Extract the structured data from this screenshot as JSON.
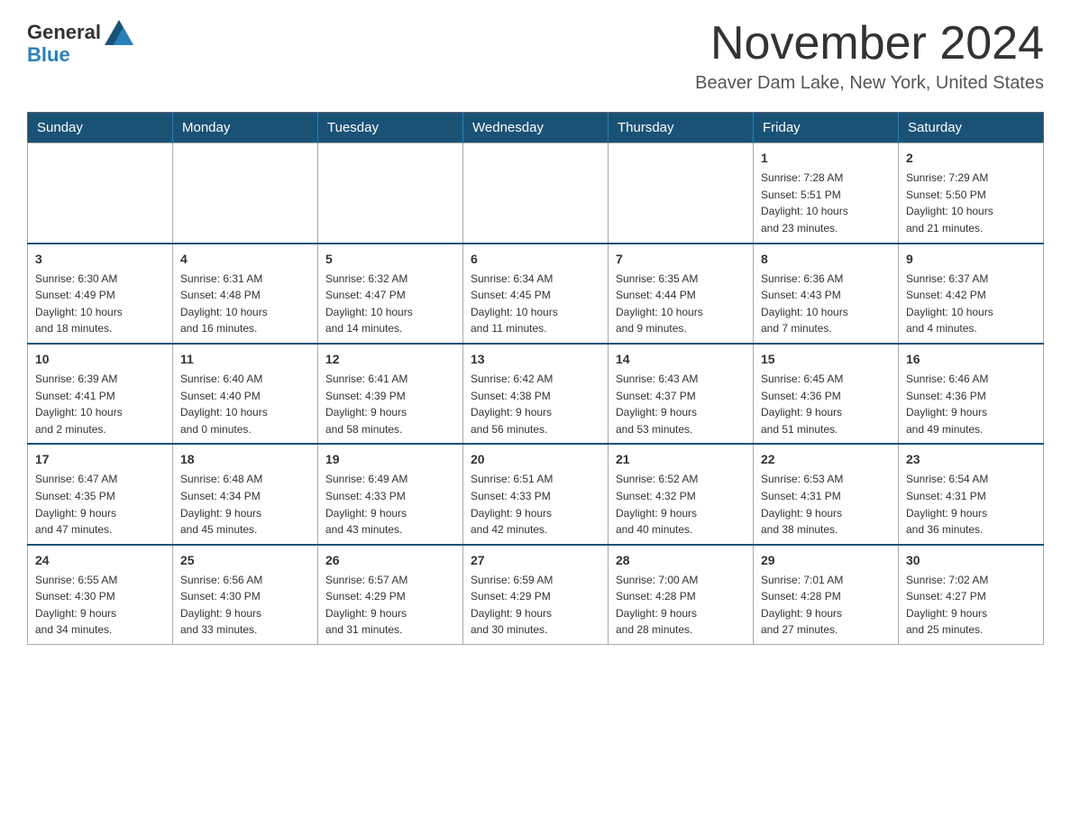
{
  "header": {
    "logo_line1": "General",
    "logo_line2": "Blue",
    "month_title": "November 2024",
    "location": "Beaver Dam Lake, New York, United States"
  },
  "days_of_week": [
    "Sunday",
    "Monday",
    "Tuesday",
    "Wednesday",
    "Thursday",
    "Friday",
    "Saturday"
  ],
  "weeks": [
    [
      {
        "day": "",
        "info": ""
      },
      {
        "day": "",
        "info": ""
      },
      {
        "day": "",
        "info": ""
      },
      {
        "day": "",
        "info": ""
      },
      {
        "day": "",
        "info": ""
      },
      {
        "day": "1",
        "info": "Sunrise: 7:28 AM\nSunset: 5:51 PM\nDaylight: 10 hours\nand 23 minutes."
      },
      {
        "day": "2",
        "info": "Sunrise: 7:29 AM\nSunset: 5:50 PM\nDaylight: 10 hours\nand 21 minutes."
      }
    ],
    [
      {
        "day": "3",
        "info": "Sunrise: 6:30 AM\nSunset: 4:49 PM\nDaylight: 10 hours\nand 18 minutes."
      },
      {
        "day": "4",
        "info": "Sunrise: 6:31 AM\nSunset: 4:48 PM\nDaylight: 10 hours\nand 16 minutes."
      },
      {
        "day": "5",
        "info": "Sunrise: 6:32 AM\nSunset: 4:47 PM\nDaylight: 10 hours\nand 14 minutes."
      },
      {
        "day": "6",
        "info": "Sunrise: 6:34 AM\nSunset: 4:45 PM\nDaylight: 10 hours\nand 11 minutes."
      },
      {
        "day": "7",
        "info": "Sunrise: 6:35 AM\nSunset: 4:44 PM\nDaylight: 10 hours\nand 9 minutes."
      },
      {
        "day": "8",
        "info": "Sunrise: 6:36 AM\nSunset: 4:43 PM\nDaylight: 10 hours\nand 7 minutes."
      },
      {
        "day": "9",
        "info": "Sunrise: 6:37 AM\nSunset: 4:42 PM\nDaylight: 10 hours\nand 4 minutes."
      }
    ],
    [
      {
        "day": "10",
        "info": "Sunrise: 6:39 AM\nSunset: 4:41 PM\nDaylight: 10 hours\nand 2 minutes."
      },
      {
        "day": "11",
        "info": "Sunrise: 6:40 AM\nSunset: 4:40 PM\nDaylight: 10 hours\nand 0 minutes."
      },
      {
        "day": "12",
        "info": "Sunrise: 6:41 AM\nSunset: 4:39 PM\nDaylight: 9 hours\nand 58 minutes."
      },
      {
        "day": "13",
        "info": "Sunrise: 6:42 AM\nSunset: 4:38 PM\nDaylight: 9 hours\nand 56 minutes."
      },
      {
        "day": "14",
        "info": "Sunrise: 6:43 AM\nSunset: 4:37 PM\nDaylight: 9 hours\nand 53 minutes."
      },
      {
        "day": "15",
        "info": "Sunrise: 6:45 AM\nSunset: 4:36 PM\nDaylight: 9 hours\nand 51 minutes."
      },
      {
        "day": "16",
        "info": "Sunrise: 6:46 AM\nSunset: 4:36 PM\nDaylight: 9 hours\nand 49 minutes."
      }
    ],
    [
      {
        "day": "17",
        "info": "Sunrise: 6:47 AM\nSunset: 4:35 PM\nDaylight: 9 hours\nand 47 minutes."
      },
      {
        "day": "18",
        "info": "Sunrise: 6:48 AM\nSunset: 4:34 PM\nDaylight: 9 hours\nand 45 minutes."
      },
      {
        "day": "19",
        "info": "Sunrise: 6:49 AM\nSunset: 4:33 PM\nDaylight: 9 hours\nand 43 minutes."
      },
      {
        "day": "20",
        "info": "Sunrise: 6:51 AM\nSunset: 4:33 PM\nDaylight: 9 hours\nand 42 minutes."
      },
      {
        "day": "21",
        "info": "Sunrise: 6:52 AM\nSunset: 4:32 PM\nDaylight: 9 hours\nand 40 minutes."
      },
      {
        "day": "22",
        "info": "Sunrise: 6:53 AM\nSunset: 4:31 PM\nDaylight: 9 hours\nand 38 minutes."
      },
      {
        "day": "23",
        "info": "Sunrise: 6:54 AM\nSunset: 4:31 PM\nDaylight: 9 hours\nand 36 minutes."
      }
    ],
    [
      {
        "day": "24",
        "info": "Sunrise: 6:55 AM\nSunset: 4:30 PM\nDaylight: 9 hours\nand 34 minutes."
      },
      {
        "day": "25",
        "info": "Sunrise: 6:56 AM\nSunset: 4:30 PM\nDaylight: 9 hours\nand 33 minutes."
      },
      {
        "day": "26",
        "info": "Sunrise: 6:57 AM\nSunset: 4:29 PM\nDaylight: 9 hours\nand 31 minutes."
      },
      {
        "day": "27",
        "info": "Sunrise: 6:59 AM\nSunset: 4:29 PM\nDaylight: 9 hours\nand 30 minutes."
      },
      {
        "day": "28",
        "info": "Sunrise: 7:00 AM\nSunset: 4:28 PM\nDaylight: 9 hours\nand 28 minutes."
      },
      {
        "day": "29",
        "info": "Sunrise: 7:01 AM\nSunset: 4:28 PM\nDaylight: 9 hours\nand 27 minutes."
      },
      {
        "day": "30",
        "info": "Sunrise: 7:02 AM\nSunset: 4:27 PM\nDaylight: 9 hours\nand 25 minutes."
      }
    ]
  ]
}
